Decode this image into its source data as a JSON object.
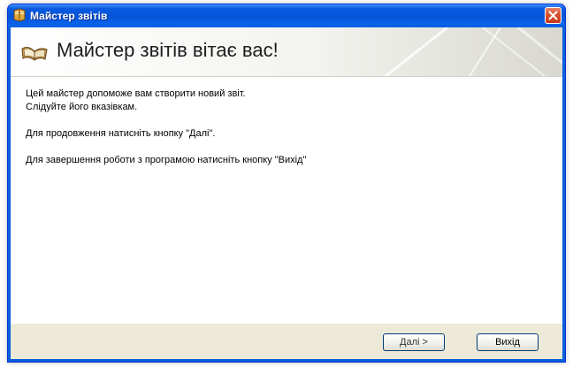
{
  "window": {
    "title": "Майстер звітів"
  },
  "header": {
    "title": "Майстер звітів вітає вас!"
  },
  "body": {
    "line1": "Цей майстер допоможе вам створити новий звіт.",
    "line2": "Слідуйте його вказівкам.",
    "line3": "Для продовження натисніть кнопку \"Далі\".",
    "line4": "Для завершення роботи з програмою натисніть кнопку \"Вихід\""
  },
  "footer": {
    "next_label": "Далі >",
    "exit_label": "Вихід"
  },
  "icons": {
    "app": "book-icon",
    "header": "open-book-icon",
    "close": "close-icon"
  },
  "colors": {
    "titlebar": "#0554d8",
    "close_button": "#d9502f",
    "footer": "#ece9d8",
    "button_border": "#003c74"
  }
}
